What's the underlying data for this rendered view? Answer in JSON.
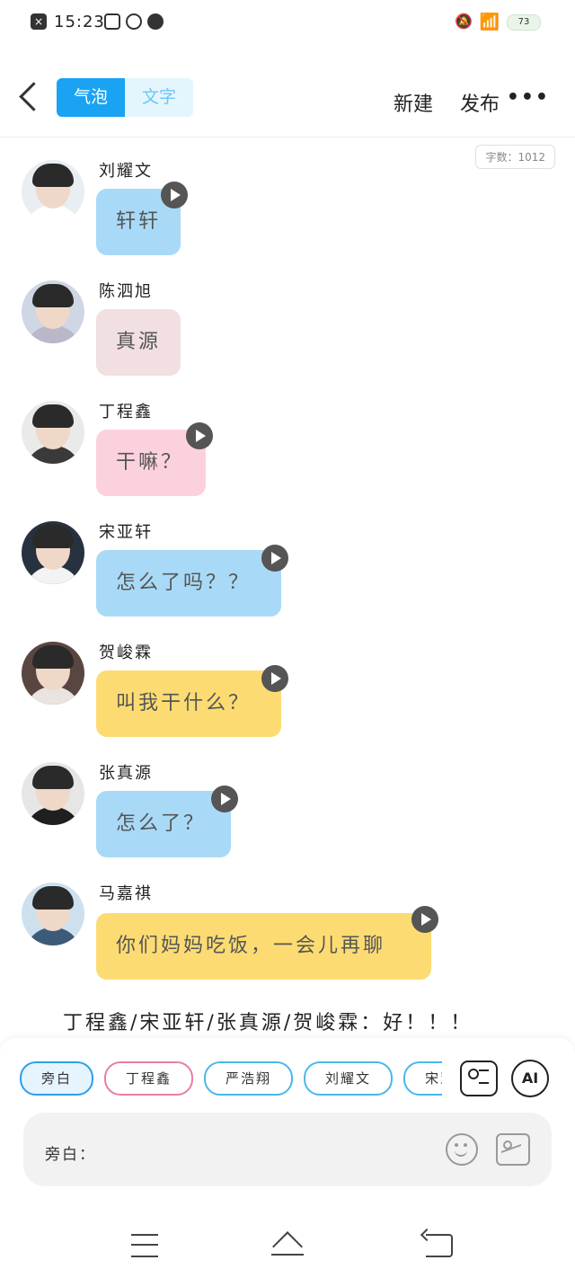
{
  "status": {
    "time": "15:23",
    "battery": "73"
  },
  "header": {
    "tab_bubble": "气泡",
    "tab_text": "文字",
    "new_label": "新建",
    "publish_label": "发布",
    "more_label": "•••"
  },
  "word_count": "字数：1012",
  "messages": [
    {
      "name": "刘耀文",
      "text": "轩轩",
      "color": "#a8daf7",
      "has_play": true
    },
    {
      "name": "陈泗旭",
      "text": "真源",
      "color": "#f1dfe2",
      "has_play": false
    },
    {
      "name": "丁程鑫",
      "text": "干嘛？",
      "color": "#fcd1de",
      "has_play": true
    },
    {
      "name": "宋亚轩",
      "text": "怎么了吗？？",
      "color": "#a8daf7",
      "has_play": true
    },
    {
      "name": "贺峻霖",
      "text": "叫我干什么？",
      "color": "#fcdc72",
      "has_play": true
    },
    {
      "name": "张真源",
      "text": "怎么了？",
      "color": "#a8daf7",
      "has_play": true
    },
    {
      "name": "马嘉祺",
      "text": "你们妈妈吃饭，一会儿再聊",
      "color": "#fcdc72",
      "has_play": true
    }
  ],
  "group_line": "丁程鑫/宋亚轩/张真源/贺峻霖：好！！！",
  "chips": [
    "旁白",
    "丁程鑫",
    "严浩翔",
    "刘耀文",
    "宋亚轩"
  ],
  "input": {
    "placeholder": "旁白："
  },
  "tools": {
    "ai_label": "AI"
  }
}
